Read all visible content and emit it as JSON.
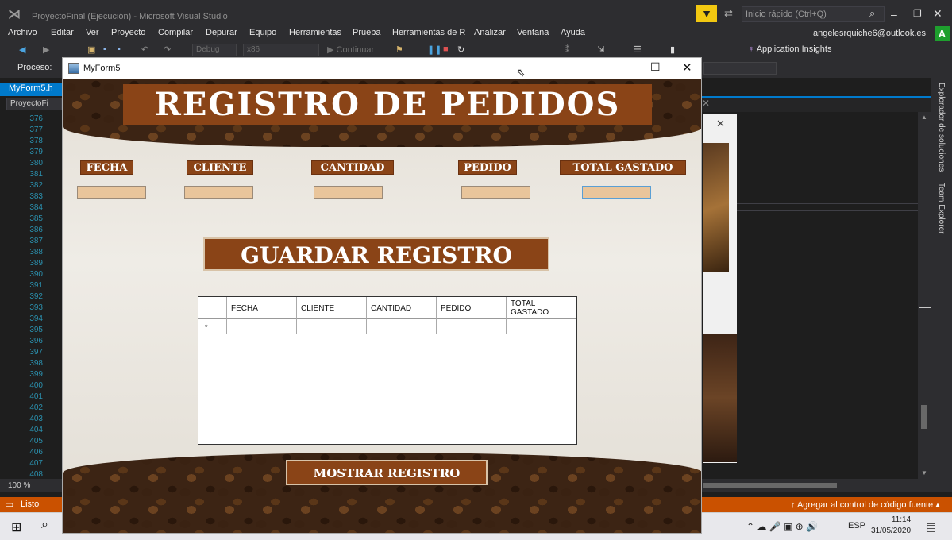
{
  "vs": {
    "title": "ProyectoFinal (Ejecución) - Microsoft Visual Studio",
    "quick_launch": "Inicio rápido (Ctrl+Q)",
    "menu": [
      "Archivo",
      "Editar",
      "Ver",
      "Proyecto",
      "Compilar",
      "Depurar",
      "Equipo",
      "Herramientas",
      "Prueba",
      "Herramientas de R",
      "Analizar",
      "Ventana",
      "Ayuda"
    ],
    "account": "angelesrquiche6@outlook.es",
    "account_initial": "A",
    "toolbar": {
      "config": "Debug",
      "platform": "x86",
      "continue": "Continuar",
      "app_insights": "Application Insights"
    },
    "process_label": "Proceso:",
    "tab_file": "MyForm5.h",
    "nav_combo": "ProyectoFi",
    "line_numbers": [
      "376",
      "377",
      "378",
      "379",
      "380",
      "381",
      "382",
      "383",
      "384",
      "385",
      "386",
      "387",
      "388",
      "389",
      "390",
      "391",
      "392",
      "393",
      "394",
      "395",
      "396",
      "397",
      "398",
      "399",
      "400",
      "401",
      "402",
      "403",
      "404",
      "405",
      "406",
      "407",
      "408"
    ],
    "zoom": "100 %",
    "side_panels": [
      "Explorador de soluciones",
      "Team Explorer"
    ],
    "status": "Listo",
    "status_right": "Agregar al control de código fuente"
  },
  "taskbar": {
    "lang": "ESP",
    "time": "11:14",
    "date": "31/05/2020"
  },
  "form": {
    "title": "MyForm5",
    "header": "REGISTRO DE PEDIDOS",
    "labels": {
      "fecha": "FECHA",
      "cliente": "CLIENTE",
      "cantidad": "CANTIDAD",
      "pedido": "PEDIDO",
      "total": "TOTAL GASTADO"
    },
    "save_button": "GUARDAR REGISTRO",
    "grid_columns": [
      "FECHA",
      "CLIENTE",
      "CANTIDAD",
      "PEDIDO",
      "TOTAL GASTADO"
    ],
    "new_row_marker": "*",
    "show_button": "MOSTRAR REGISTRO"
  }
}
